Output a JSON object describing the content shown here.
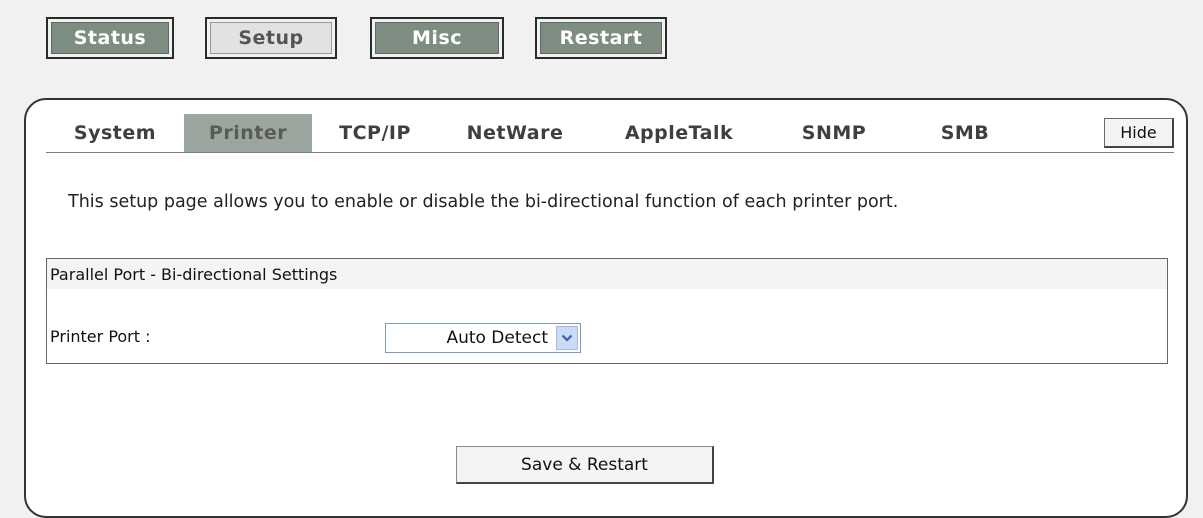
{
  "topnav": {
    "status": "Status",
    "setup": "Setup",
    "misc": "Misc",
    "restart": "Restart",
    "active": "Setup"
  },
  "tabs": {
    "items": [
      "System",
      "Printer",
      "TCP/IP",
      "NetWare",
      "AppleTalk",
      "SNMP",
      "SMB"
    ],
    "active": "Printer",
    "hide_label": "Hide"
  },
  "description": "This setup page allows you to enable or disable the bi-directional function of each printer port.",
  "settings": {
    "section_title": "Parallel Port - Bi-directional Settings",
    "printer_port_label": "Printer Port :",
    "printer_port_value": "Auto Detect"
  },
  "actions": {
    "save_label": "Save & Restart"
  },
  "colors": {
    "nav_button_bg": "#7e8d82",
    "active_tab_bg": "#9ba69e",
    "dropdown_arrow_bg": "#c9dbf7"
  },
  "icons": {
    "dropdown": "chevron-down-icon"
  }
}
